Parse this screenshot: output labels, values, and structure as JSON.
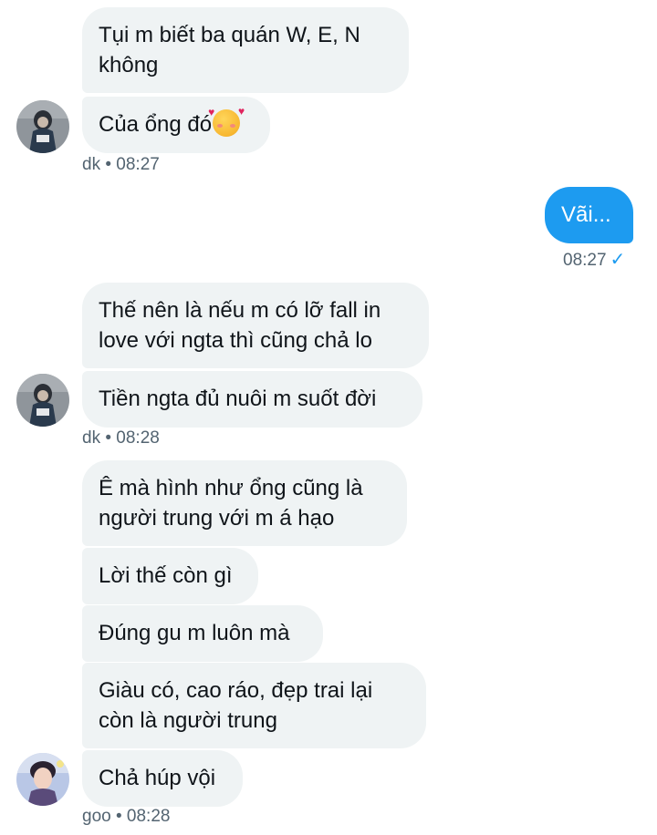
{
  "messages": {
    "m1": "Tụi m biết ba quán W, E, N không",
    "m2": "Của ổng đó",
    "m2_emoji": "smiling-face-with-hearts-icon",
    "meta1_sender": "dk",
    "meta1_time": "08:27",
    "m3": "Vãi...",
    "meta2_time": "08:27",
    "m4": "Thế nên là nếu m có lỡ fall in love với ngta thì cũng chả lo",
    "m5": "Tiền ngta đủ nuôi m suốt đời",
    "meta3_sender": "dk",
    "meta3_time": "08:28",
    "m6": "Ê mà hình như ổng cũng là người trung với m á hạo",
    "m7": "Lời thế còn gì",
    "m8": "Đúng gu m luôn mà",
    "m9": "Giàu có, cao ráo, đẹp trai lại còn là người trung",
    "m10": "Chả húp vội",
    "meta4_sender": "goo",
    "meta4_time": "08:28"
  },
  "separator": "•",
  "colors": {
    "accent": "#1d9bf0",
    "bubble_in": "#eff3f4",
    "meta": "#536471"
  }
}
